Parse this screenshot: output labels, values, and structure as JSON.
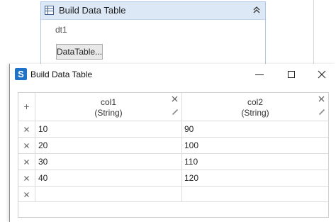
{
  "activity": {
    "title": "Build Data Table",
    "output_variable": "dt1",
    "datatable_button": "DataTable..."
  },
  "dialog": {
    "title": "Build Data Table",
    "icon_glyph": "S",
    "accent_color": "#1e73c9"
  },
  "table": {
    "add_column_symbol": "+",
    "columns": [
      {
        "name": "col1",
        "type": "(String)"
      },
      {
        "name": "col2",
        "type": "(String)"
      }
    ],
    "rows": [
      [
        "10",
        "90"
      ],
      [
        "20",
        "100"
      ],
      [
        "30",
        "110"
      ],
      [
        "40",
        "120"
      ],
      [
        "",
        ""
      ]
    ]
  }
}
